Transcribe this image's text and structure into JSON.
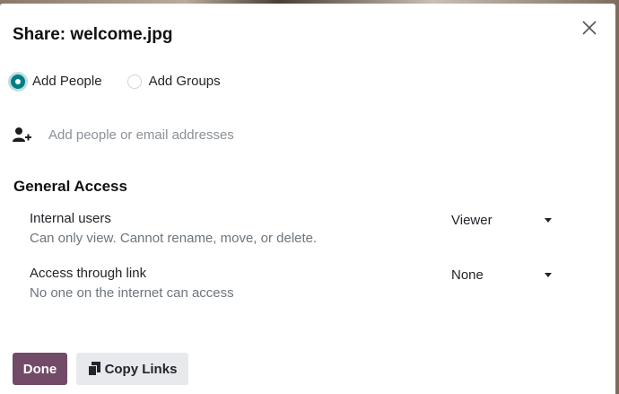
{
  "dialog": {
    "title": "Share: welcome.jpg"
  },
  "share_mode": {
    "options": [
      {
        "label": "Add People",
        "checked": true
      },
      {
        "label": "Add Groups",
        "checked": false
      }
    ]
  },
  "people": {
    "placeholder": "Add people or email addresses",
    "icon": "user-plus-icon"
  },
  "general_access": {
    "title": "General Access",
    "rows": [
      {
        "name": "Internal users",
        "description": "Can only view. Cannot rename, move, or delete.",
        "value": "Viewer"
      },
      {
        "name": "Access through link",
        "description": "No one on the internet can access",
        "value": "None"
      }
    ]
  },
  "footer": {
    "done_label": "Done",
    "copy_label": "Copy Links"
  },
  "colors": {
    "primary": "#714b67",
    "accent": "#017e84",
    "secondary_button": "#e7e9ed"
  }
}
